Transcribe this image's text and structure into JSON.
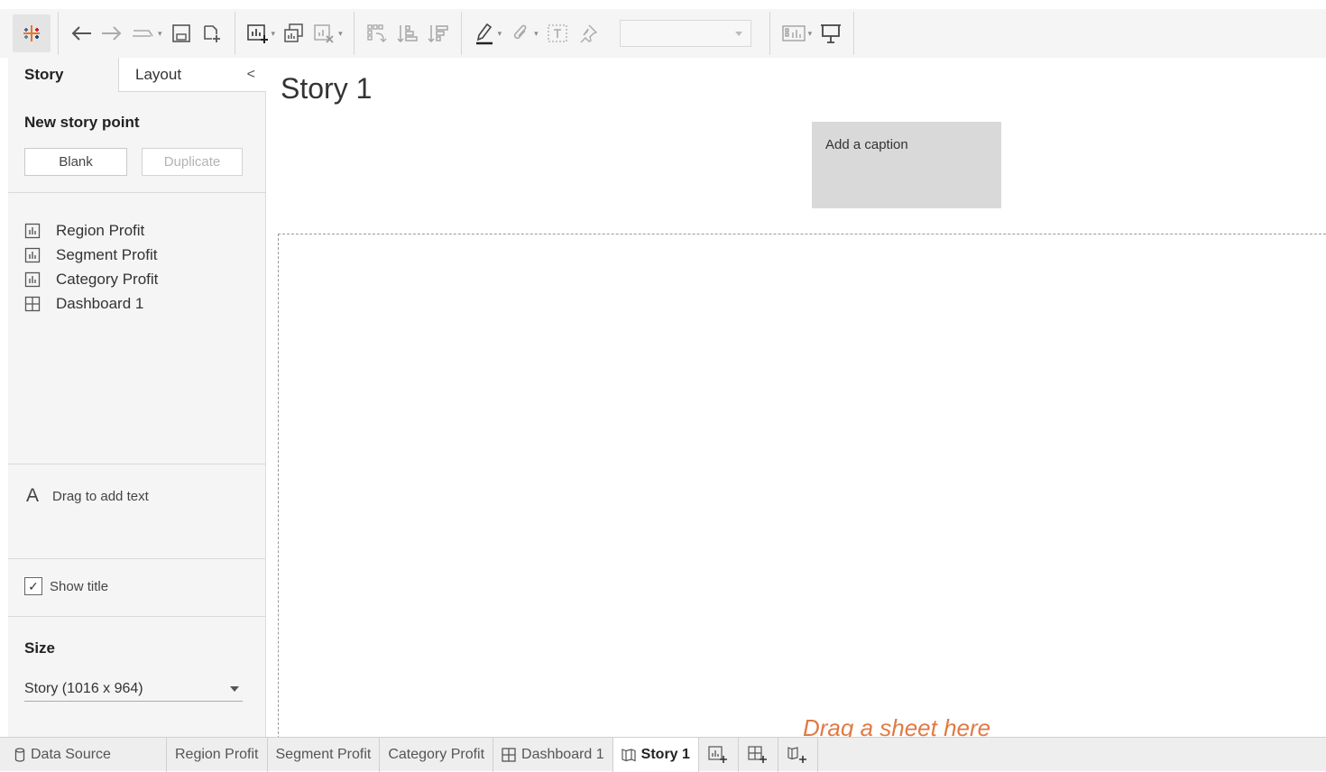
{
  "side_panel": {
    "tabs": {
      "story": "Story",
      "layout": "Layout"
    },
    "new_story_point": {
      "heading": "New story point",
      "blank": "Blank",
      "duplicate": "Duplicate"
    },
    "sheets": [
      {
        "label": "Region Profit",
        "icon": "bar-chart-icon"
      },
      {
        "label": "Segment Profit",
        "icon": "bar-chart-icon"
      },
      {
        "label": "Category Profit",
        "icon": "bar-chart-icon"
      },
      {
        "label": "Dashboard 1",
        "icon": "dashboard-grid-icon"
      }
    ],
    "drag_text": "Drag to add text",
    "show_title": {
      "label": "Show title",
      "checked": true
    },
    "size": {
      "heading": "Size",
      "value": "Story (1016 x 964)"
    }
  },
  "main": {
    "story_title": "Story 1",
    "caption": "Add a caption",
    "drop_hint": "Drag a sheet here"
  },
  "bottom_tabs": [
    {
      "label": "Data Source",
      "icon": "database-icon"
    },
    {
      "label": "Region Profit"
    },
    {
      "label": "Segment Profit"
    },
    {
      "label": "Category Profit"
    },
    {
      "label": "Dashboard 1",
      "icon": "dashboard-grid-icon"
    },
    {
      "label": "Story 1",
      "icon": "story-book-icon",
      "active": true
    }
  ],
  "colors": {
    "accent_orange": "#e07a45",
    "caption_bg": "#d9d9d9",
    "panel_bg": "#f5f5f5"
  }
}
